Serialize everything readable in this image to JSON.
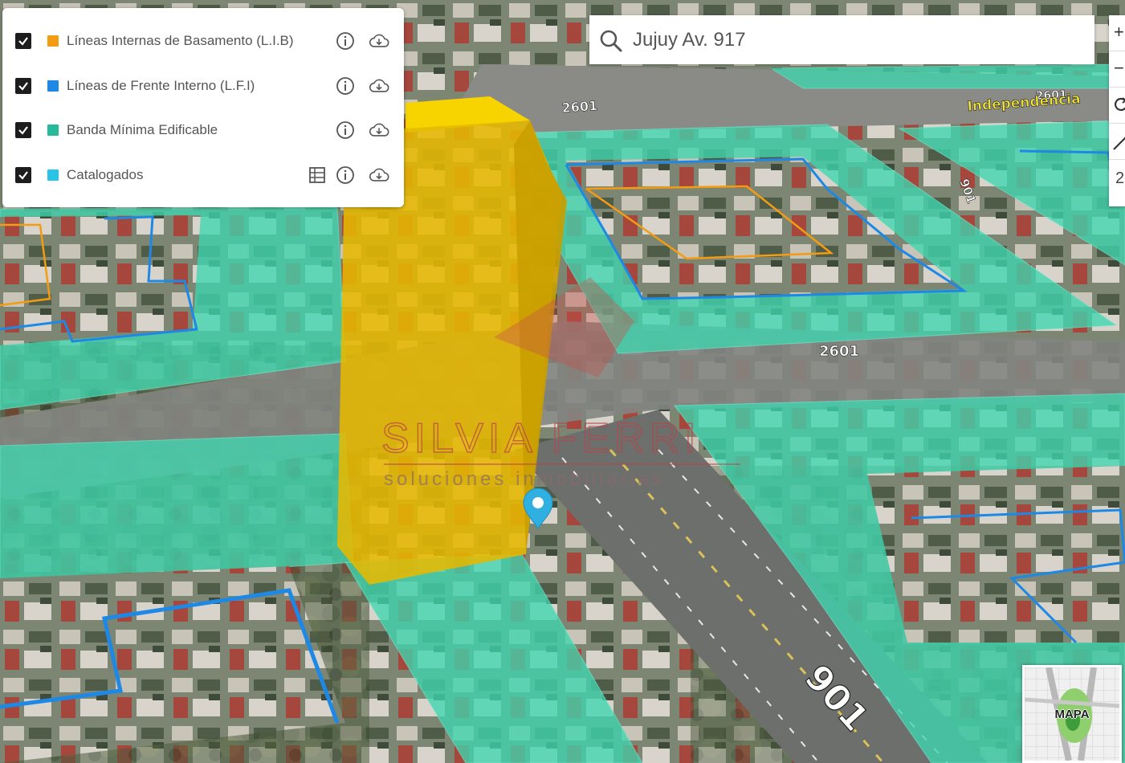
{
  "search": {
    "value": "Jujuy Av. 917",
    "placeholder": ""
  },
  "layers": [
    {
      "label": "Líneas Internas de Basamento (L.I.B)",
      "checked": true,
      "color": "#f39c12",
      "actions": [
        "info-icon",
        "cloud-download-icon"
      ]
    },
    {
      "label": "Líneas de Frente Interno (L.F.I)",
      "checked": true,
      "color": "#1e88e5",
      "actions": [
        "info-icon",
        "cloud-download-icon"
      ]
    },
    {
      "label": "Banda Mínima Edificable",
      "checked": true,
      "color": "#26b99a",
      "actions": [
        "info-icon",
        "cloud-download-icon"
      ]
    },
    {
      "label": "Catalogados",
      "checked": true,
      "color": "#29c4e8",
      "actions": [
        "table-icon",
        "info-icon",
        "cloud-download-icon"
      ]
    }
  ],
  "toolbar": {
    "zoom_in": "+",
    "zoom_out": "−",
    "zoom_level": "2"
  },
  "map": {
    "street_numbers": [
      "2601",
      "2601",
      "2601",
      "901",
      "901"
    ],
    "street_name": "Independencia",
    "watermark": {
      "brand": "SILVIA FERRI",
      "tagline": "soluciones inmobiliarias"
    },
    "colors": {
      "buildable_band": "#3fd6b0",
      "volume": "#f2c200",
      "frente_interno": "#1e88e5",
      "basamento": "#f39c12",
      "marker": "#2fb0e0"
    }
  },
  "minimap": {
    "label": "MAPA"
  }
}
